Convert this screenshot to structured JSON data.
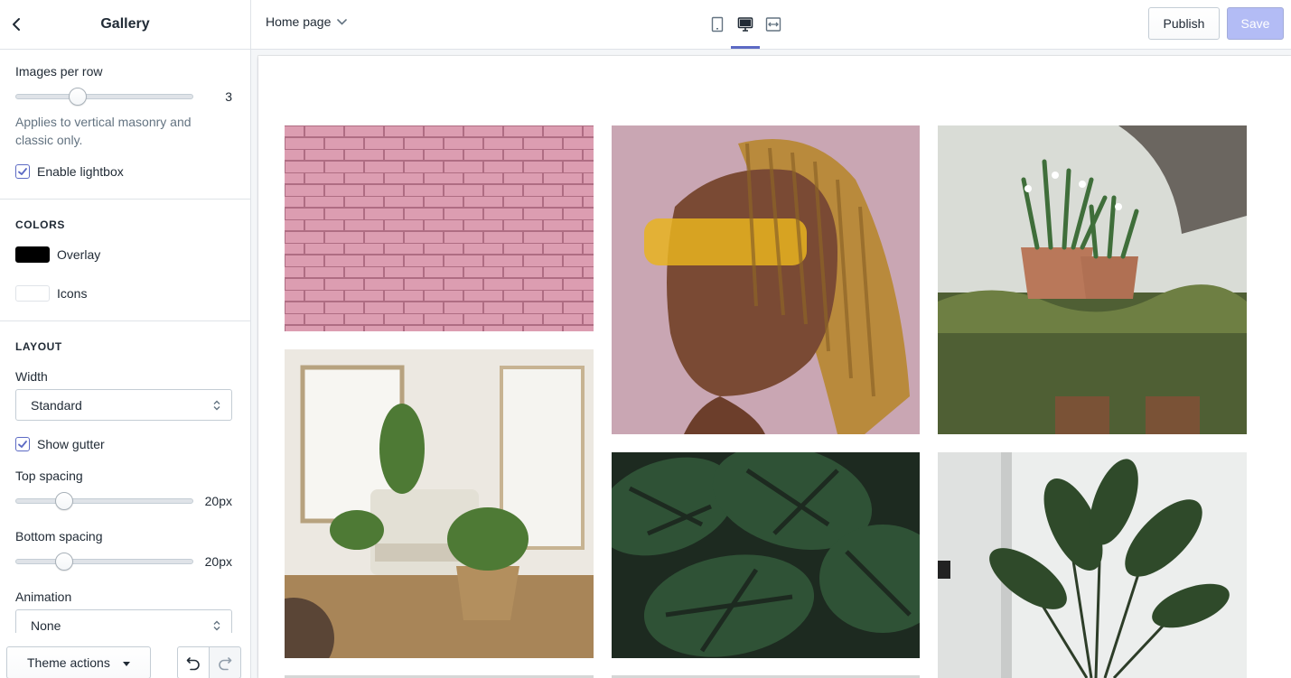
{
  "sidebar": {
    "title": "Gallery",
    "images_per_row": {
      "label": "Images per row",
      "value": "3",
      "level": 0.33
    },
    "help_text": "Applies to vertical masonry and classic only.",
    "enable_lightbox": {
      "label": "Enable lightbox",
      "checked": true
    },
    "colors": {
      "heading": "COLORS",
      "overlay": {
        "label": "Overlay",
        "color": "#000000"
      },
      "icons": {
        "label": "Icons",
        "color": "#ffffff"
      }
    },
    "layout": {
      "heading": "LAYOUT",
      "width_label": "Width",
      "width_value": "Standard",
      "show_gutter": {
        "label": "Show gutter",
        "checked": true
      },
      "top_spacing": {
        "label": "Top spacing",
        "value": "20px",
        "level": 0.25
      },
      "bottom_spacing": {
        "label": "Bottom spacing",
        "value": "20px",
        "level": 0.25
      },
      "animation_label": "Animation",
      "animation_value": "None"
    },
    "footer": {
      "theme_actions": "Theme actions"
    }
  },
  "topbar": {
    "page": "Home page",
    "devices": [
      "mobile-icon",
      "desktop-icon",
      "fullscreen-icon"
    ],
    "active_device": "desktop-icon",
    "publish": "Publish",
    "save": "Save"
  },
  "colors": {
    "accent": "#5c6ac4",
    "save_disabled": "#b3bcf5"
  },
  "gallery": {
    "images": [
      "pink brick wall",
      "woman with braids and yellow sunglasses",
      "potted snowdrops on mossy ledge",
      "living room with plants and chair",
      "monstera leaves",
      "bird of paradise plant"
    ]
  }
}
